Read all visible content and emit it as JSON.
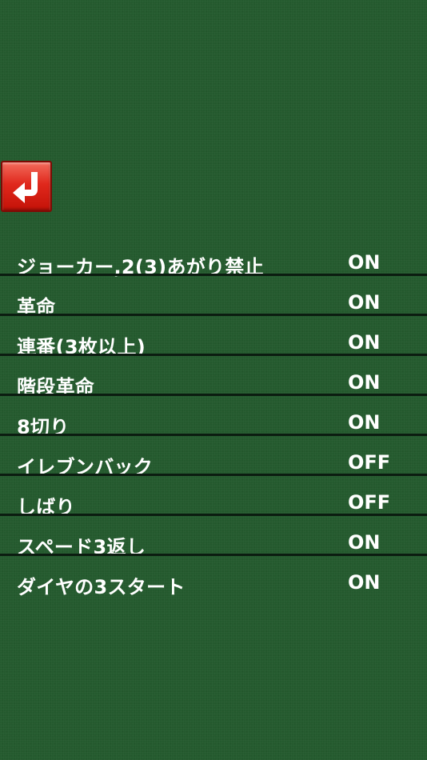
{
  "back_button": {
    "icon": "return-arrow-icon",
    "color": "#e0281c"
  },
  "settings": [
    {
      "label": "ジョーカー,2(3)あがり禁止",
      "value": "ON"
    },
    {
      "label": "革命",
      "value": "ON"
    },
    {
      "label": "連番(3枚以上)",
      "value": "ON"
    },
    {
      "label": "階段革命",
      "value": "ON"
    },
    {
      "label": "8切り",
      "value": "ON"
    },
    {
      "label": "イレブンバック",
      "value": "OFF"
    },
    {
      "label": "しばり",
      "value": "OFF"
    },
    {
      "label": "スペード3返し",
      "value": "ON"
    },
    {
      "label": "ダイヤの3スタート",
      "value": "ON"
    }
  ],
  "colors": {
    "background": "#245a2e",
    "divider": "#0b1c10",
    "text": "#ffffff"
  }
}
